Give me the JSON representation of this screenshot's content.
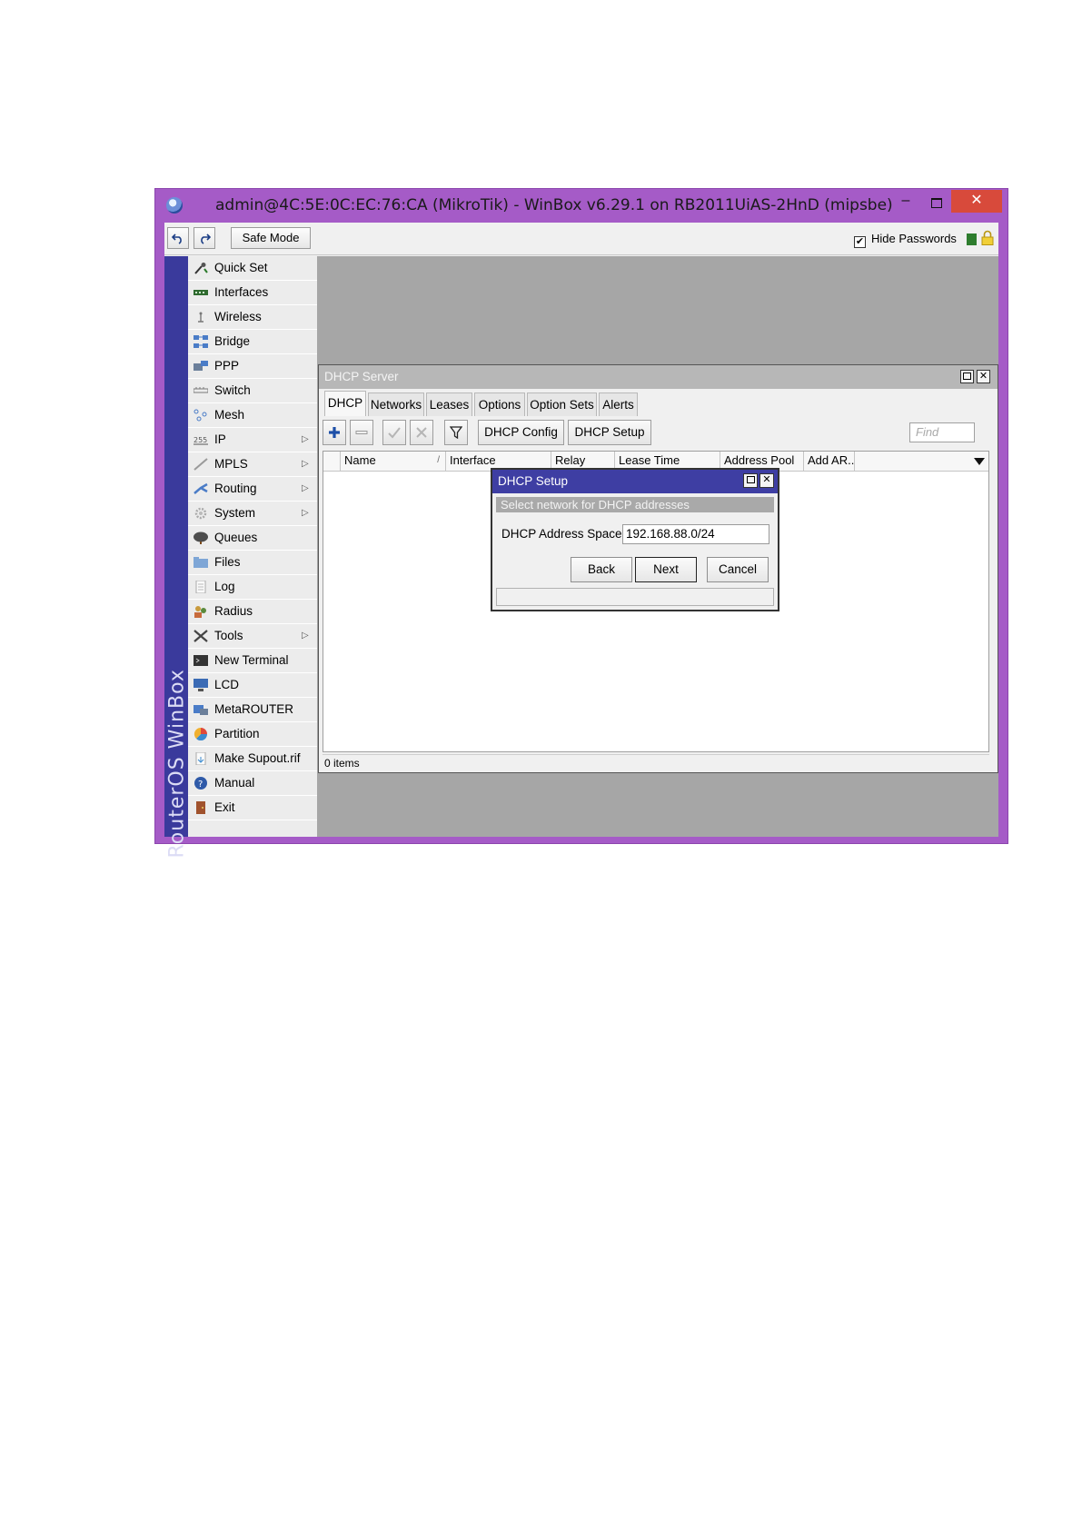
{
  "window": {
    "title": "admin@4C:5E:0C:EC:76:CA (MikroTik) - WinBox v6.29.1 on RB2011UiAS-2HnD (mipsbe)",
    "minimize_glyph": "–",
    "close_glyph": "✕"
  },
  "toolbar": {
    "safe_mode_label": "Safe Mode",
    "hide_passwords_label": "Hide Passwords",
    "hide_passwords_checked": "✔"
  },
  "sidebar": {
    "brand": "RouterOS WinBox",
    "items": [
      {
        "label": "Quick Set",
        "icon": "wizard-icon",
        "submenu": false
      },
      {
        "label": "Interfaces",
        "icon": "interfaces-icon",
        "submenu": false
      },
      {
        "label": "Wireless",
        "icon": "wireless-icon",
        "submenu": false
      },
      {
        "label": "Bridge",
        "icon": "bridge-icon",
        "submenu": false
      },
      {
        "label": "PPP",
        "icon": "ppp-icon",
        "submenu": false
      },
      {
        "label": "Switch",
        "icon": "switch-icon",
        "submenu": false
      },
      {
        "label": "Mesh",
        "icon": "mesh-icon",
        "submenu": false
      },
      {
        "label": "IP",
        "icon": "ip-icon",
        "submenu": true
      },
      {
        "label": "MPLS",
        "icon": "mpls-icon",
        "submenu": true
      },
      {
        "label": "Routing",
        "icon": "routing-icon",
        "submenu": true
      },
      {
        "label": "System",
        "icon": "system-icon",
        "submenu": true
      },
      {
        "label": "Queues",
        "icon": "queues-icon",
        "submenu": false
      },
      {
        "label": "Files",
        "icon": "files-icon",
        "submenu": false
      },
      {
        "label": "Log",
        "icon": "log-icon",
        "submenu": false
      },
      {
        "label": "Radius",
        "icon": "radius-icon",
        "submenu": false
      },
      {
        "label": "Tools",
        "icon": "tools-icon",
        "submenu": true
      },
      {
        "label": "New Terminal",
        "icon": "terminal-icon",
        "submenu": false
      },
      {
        "label": "LCD",
        "icon": "lcd-icon",
        "submenu": false
      },
      {
        "label": "MetaROUTER",
        "icon": "metarouter-icon",
        "submenu": false
      },
      {
        "label": "Partition",
        "icon": "partition-icon",
        "submenu": false
      },
      {
        "label": "Make Supout.rif",
        "icon": "supout-icon",
        "submenu": false
      },
      {
        "label": "Manual",
        "icon": "manual-icon",
        "submenu": false
      },
      {
        "label": "Exit",
        "icon": "exit-icon",
        "submenu": false
      }
    ],
    "submenu_glyph": "▷"
  },
  "dhcp_server": {
    "title": "DHCP Server",
    "tabs": [
      "DHCP",
      "Networks",
      "Leases",
      "Options",
      "Option Sets",
      "Alerts"
    ],
    "active_tab": "DHCP",
    "buttons": {
      "config": "DHCP Config",
      "setup": "DHCP Setup"
    },
    "find_placeholder": "Find",
    "columns": [
      "Name",
      "Interface",
      "Relay",
      "Lease Time",
      "Address Pool",
      "Add AR..."
    ],
    "sort_glyph": "/",
    "rows": [],
    "footer": "0 items"
  },
  "dhcp_setup": {
    "title": "DHCP Setup",
    "subtitle": "Select network for DHCP addresses",
    "field_label": "DHCP Address Space:",
    "field_value": "192.168.88.0/24",
    "buttons": {
      "back": "Back",
      "next": "Next",
      "cancel": "Cancel"
    }
  },
  "colors": {
    "window_frame": "#a55bc7",
    "close_button": "#d84a3b",
    "side_strip": "#3a3a9c",
    "dialog_title": "#3e3ea3"
  }
}
